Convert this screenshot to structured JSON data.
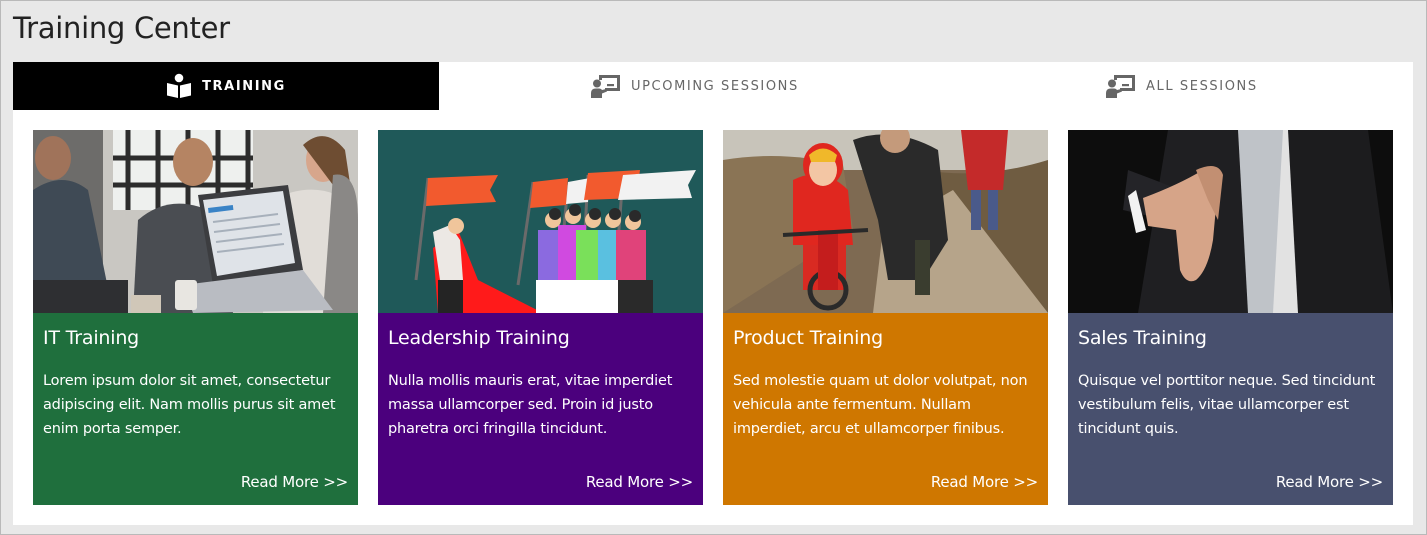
{
  "page": {
    "title": "Training Center"
  },
  "tabs": [
    {
      "label": "TRAINING",
      "icon": "book-reader-icon",
      "active": true
    },
    {
      "label": "UPCOMING SESSIONS",
      "icon": "presenter-board-icon",
      "active": false
    },
    {
      "label": "ALL SESSIONS",
      "icon": "presenter-board-icon",
      "active": false
    }
  ],
  "cards": [
    {
      "title": "IT Training",
      "description": "Lorem ipsum dolor sit amet, consectetur adipiscing elit. Nam mollis purus sit amet enim porta semper.",
      "link": "Read More >>",
      "color": "#1f6f3d",
      "image": "office-team-laptop-photo"
    },
    {
      "title": "Leadership Training",
      "description": "Nulla mollis mauris erat, vitae imperdiet massa ullamcorper sed. Proin id justo pharetra orci fringilla tincidunt.",
      "link": "Read More >>",
      "color": "#4b007d",
      "image": "leader-with-flags-illustration"
    },
    {
      "title": "Product Training",
      "description": "Sed molestie quam ut dolor volutpat, non vehicula ante fermentum. Nullam imperdiet, arcu et ullamcorper finibus.",
      "link": "Read More >>",
      "color": "#cf7700",
      "image": "child-bicycle-photo"
    },
    {
      "title": "Sales Training",
      "description": "Quisque vel porttitor neque. Sed tincidunt vestibulum felis, vitae ullamcorper est tincidunt quis.",
      "link": "Read More >>",
      "color": "#48506e",
      "image": "handshake-offer-photo"
    }
  ]
}
